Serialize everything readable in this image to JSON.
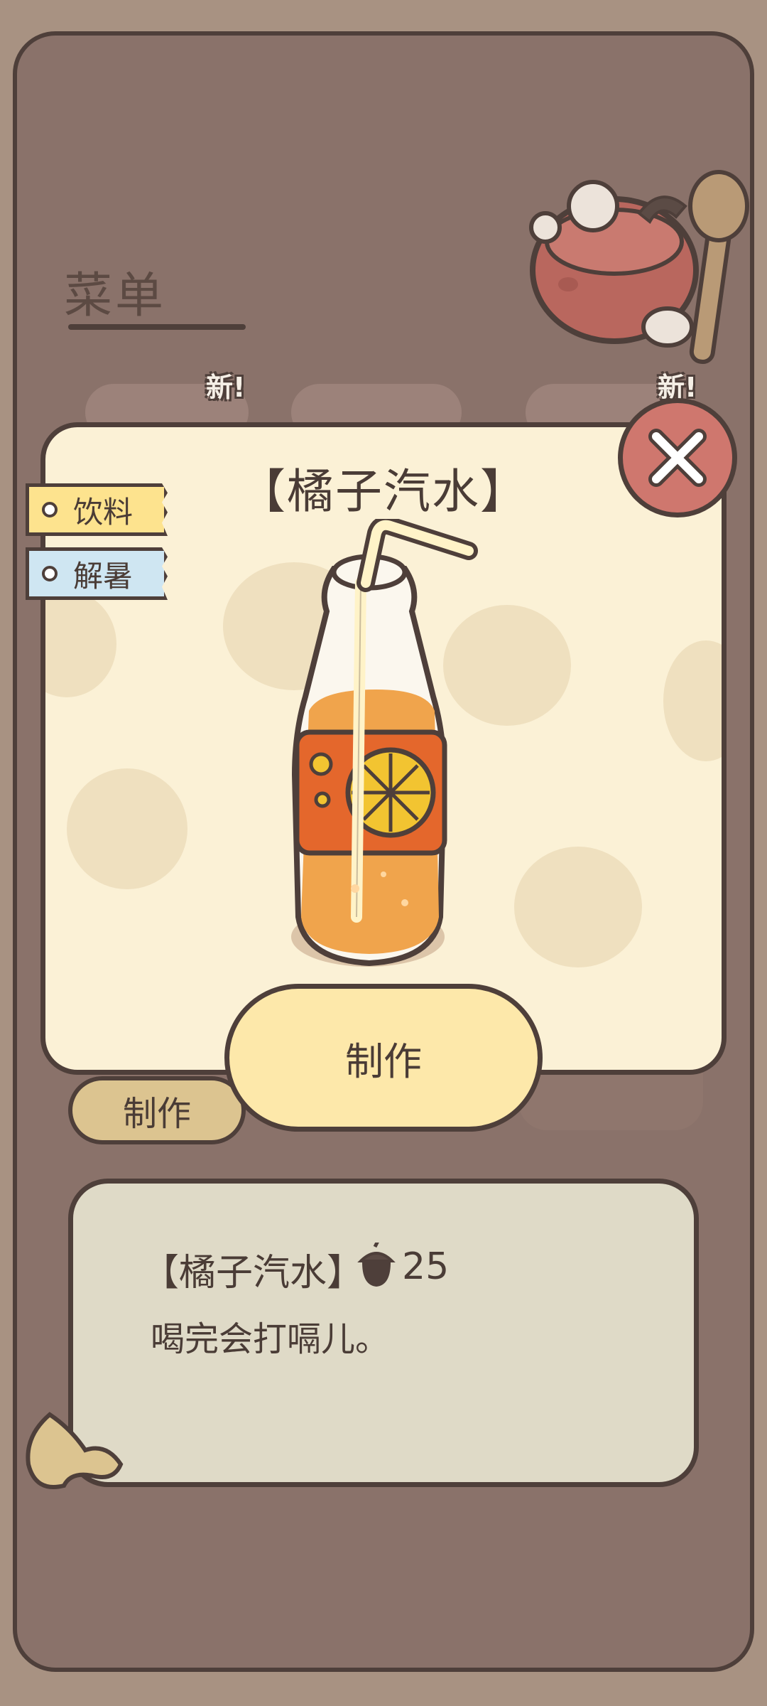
{
  "page": {
    "title": "菜单"
  },
  "badges": {
    "new_left": "新!",
    "new_right": "新!"
  },
  "background": {
    "make_label": "制作"
  },
  "modal": {
    "title": "【橘子汽水】",
    "tags": [
      {
        "label": "饮料",
        "color": "#fde38e"
      },
      {
        "label": "解暑",
        "color": "#cfe6f2"
      }
    ],
    "make_label": "制作"
  },
  "description": {
    "name": "【橘子汽水】",
    "price": "25",
    "currency_icon": "acorn-icon",
    "text": "喝完会打嗝儿。"
  },
  "colors": {
    "frame": "#8a726a",
    "modal": "#fbf1d6",
    "close": "#cf776e",
    "button": "#fde8aa",
    "outline": "#4e3f3a"
  }
}
